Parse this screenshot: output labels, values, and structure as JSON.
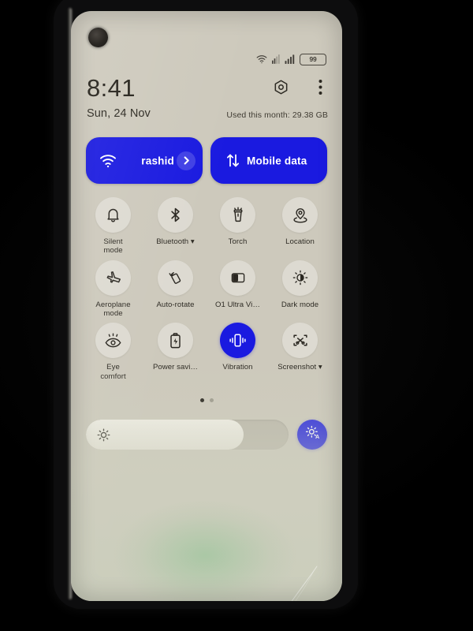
{
  "device": {
    "frame_color": "#0d0d0e",
    "screen_bg": "#cdc9bc",
    "accent": "#1a1ae0"
  },
  "status_bar": {
    "wifi_icon": "wifi-icon",
    "sim_icon": "sim-signal-icon",
    "signal_icon": "signal-bars-icon",
    "battery_level": "99"
  },
  "header": {
    "clock": "8:41",
    "date": "Sun, 24 Nov",
    "settings_icon": "settings-hex-icon",
    "overflow_icon": "more-vertical-icon",
    "data_usage": "Used this month: 29.38 GB"
  },
  "big_tiles": [
    {
      "name": "wifi",
      "icon": "wifi-icon",
      "label": "rashid",
      "active": true,
      "expand_icon": "chevron-right-icon"
    },
    {
      "name": "mobile-data",
      "icon": "mobile-data-arrows-icon",
      "label": "Mobile data",
      "active": true
    }
  ],
  "toggles": [
    {
      "id": "silent-mode",
      "icon": "bell-icon",
      "label": "Silent\nmode",
      "active": false
    },
    {
      "id": "bluetooth",
      "icon": "bluetooth-icon",
      "label": "Bluetooth ▾",
      "active": false
    },
    {
      "id": "torch",
      "icon": "torch-icon",
      "label": "Torch",
      "active": false
    },
    {
      "id": "location",
      "icon": "location-pin-icon",
      "label": "Location",
      "active": false
    },
    {
      "id": "aeroplane-mode",
      "icon": "airplane-icon",
      "label": "Aeroplane\nmode",
      "active": false
    },
    {
      "id": "auto-rotate",
      "icon": "auto-rotate-icon",
      "label": "Auto-rotate",
      "active": false
    },
    {
      "id": "o1-ultra-vision",
      "icon": "ultra-vision-icon",
      "label": "O1 Ultra Vi…",
      "active": false
    },
    {
      "id": "dark-mode",
      "icon": "dark-mode-icon",
      "label": "Dark mode",
      "active": false
    },
    {
      "id": "eye-comfort",
      "icon": "eye-icon",
      "label": "Eye\ncomfort",
      "active": false
    },
    {
      "id": "power-saving",
      "icon": "battery-save-icon",
      "label": "Power savi…",
      "active": false
    },
    {
      "id": "vibration",
      "icon": "vibration-icon",
      "label": "Vibration",
      "active": true
    },
    {
      "id": "screenshot",
      "icon": "screenshot-icon",
      "label": "Screenshot ▾",
      "active": false
    }
  ],
  "pagination": {
    "total": 2,
    "active_index": 0
  },
  "brightness": {
    "value_percent": 78,
    "sun_icon": "brightness-sun-icon",
    "auto_icon": "brightness-auto-icon"
  }
}
